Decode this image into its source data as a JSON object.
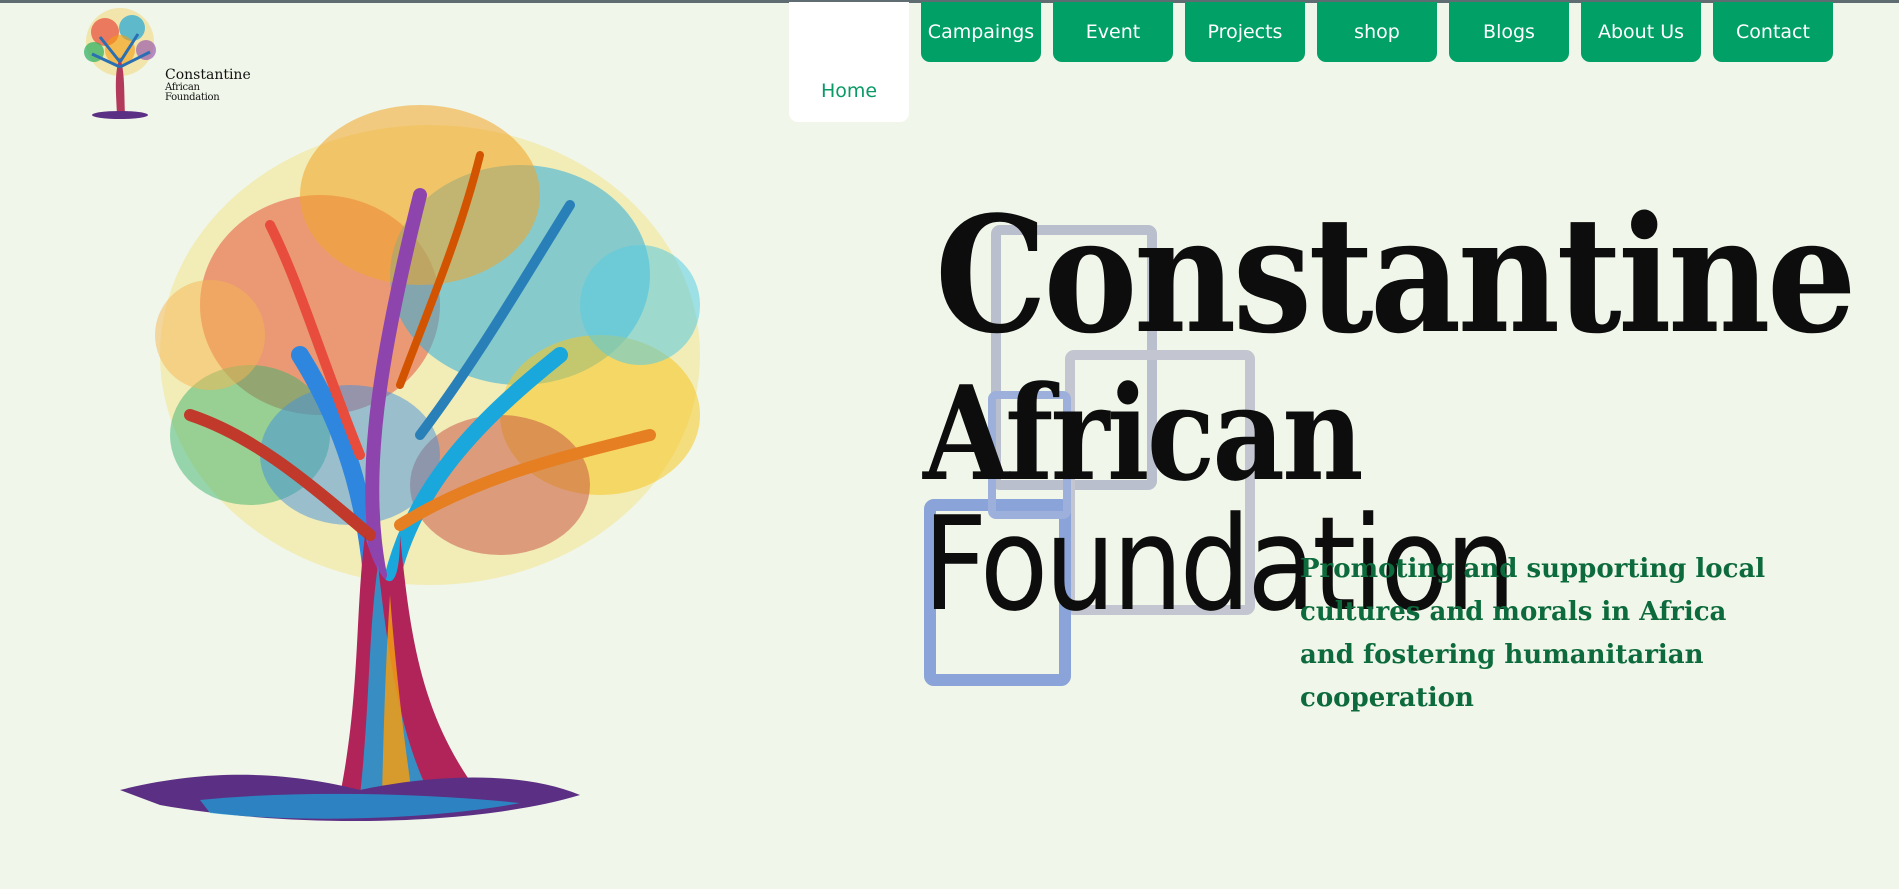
{
  "colors": {
    "background": "#f0f6e9",
    "nav_green": "#00a067",
    "nav_active_text": "#0a9a66",
    "tagline": "#0c6a3c"
  },
  "logo": {
    "line1": "Constantine",
    "line2": "African Foundation",
    "icon": "tree-of-hands-icon"
  },
  "nav": {
    "items": [
      {
        "label": "Home",
        "active": true
      },
      {
        "label": "Campaings",
        "active": false
      },
      {
        "label": "Event",
        "active": false
      },
      {
        "label": "Projects",
        "active": false
      },
      {
        "label": "shop",
        "active": false
      },
      {
        "label": "Blogs",
        "active": false
      },
      {
        "label": "About Us",
        "active": false
      },
      {
        "label": "Contact",
        "active": false
      }
    ]
  },
  "hero": {
    "title_line1": "Constantine",
    "title_word1": "African",
    "title_word2": "Foundation",
    "tagline": "Promoting and supporting local cultures and morals in Africa and fostering humanitarian cooperation"
  }
}
